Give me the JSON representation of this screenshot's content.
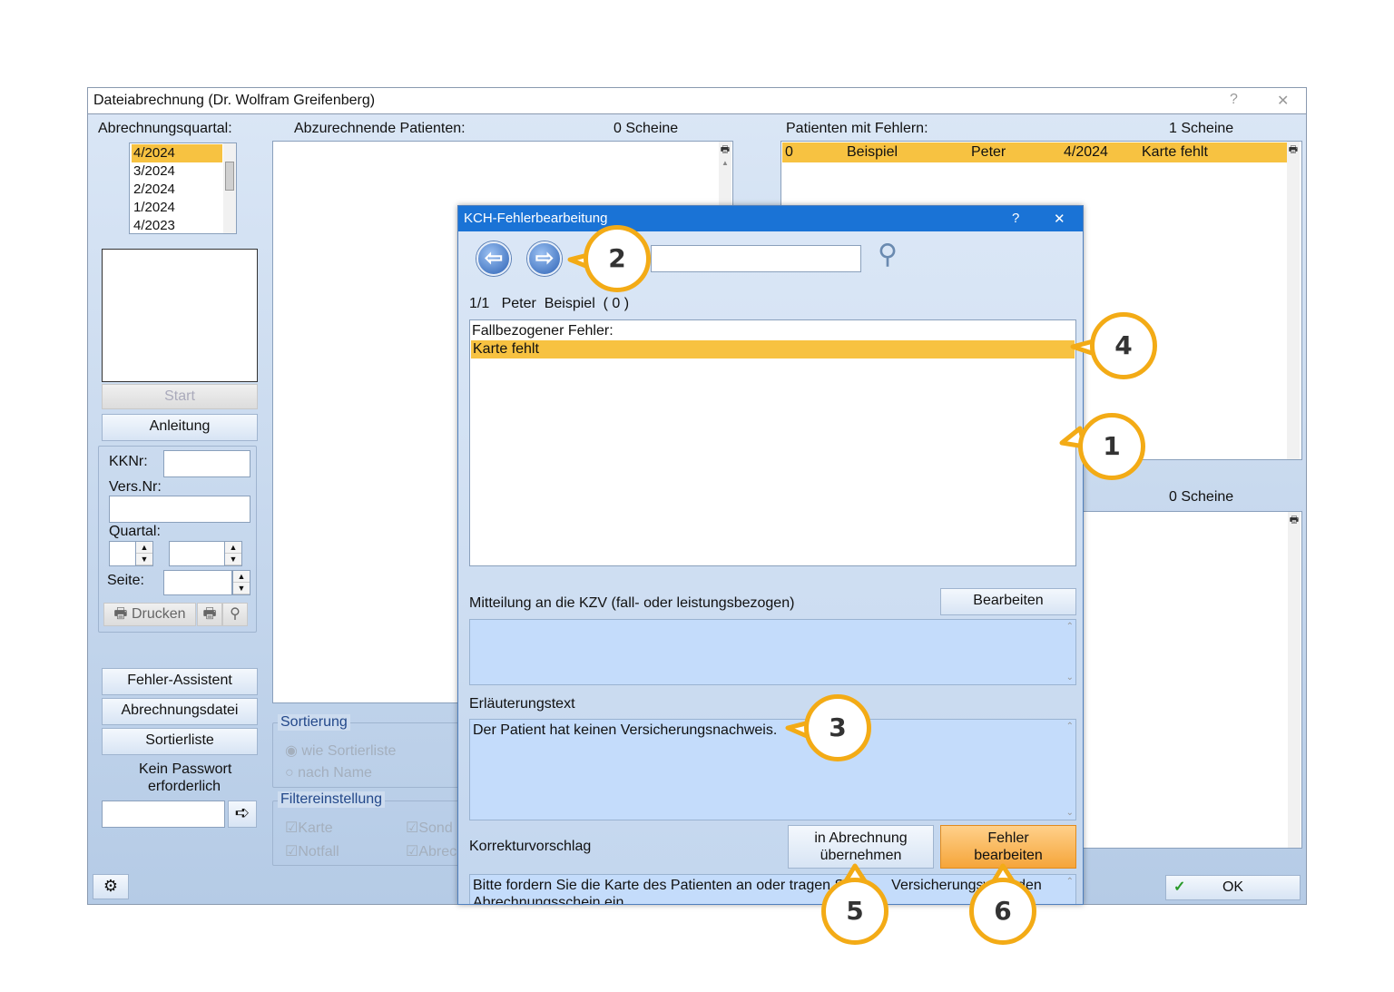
{
  "window": {
    "title": "Dateiabrechnung (Dr. Wolfram Greifenberg)",
    "help": "?",
    "close": "✕"
  },
  "left": {
    "quarter_label": "Abrechnungsquartal:",
    "quarters": [
      "4/2024",
      "3/2024",
      "2/2024",
      "1/2024",
      "4/2023"
    ],
    "start": "Start",
    "anleitung": "Anleitung",
    "kknr_label": "KKNr:",
    "versnr_label": "Vers.Nr:",
    "quartal_label": "Quartal:",
    "seite_label": "Seite:",
    "drucken": "Drucken",
    "fehler_assistent": "Fehler-Assistent",
    "abrechnungsdatei": "Abrechnungsdatei",
    "sortierliste": "Sortierliste",
    "password_line1": "Kein Passwort",
    "password_line2": "erforderlich"
  },
  "middle": {
    "patients_label": "Abzurechnende Patienten:",
    "patients_count": "0  Scheine",
    "sort_title": "Sortierung",
    "sort_opt1": "wie Sortierliste",
    "sort_opt2": "nach Name",
    "filter_title": "Filtereinstellung",
    "filter_karte": "Karte",
    "filter_notfall": "Notfall",
    "filter_sond": "Sond",
    "filter_abrec": "Abrec"
  },
  "right": {
    "errors_label": "Patienten mit Fehlern:",
    "errors_count": "1  Scheine",
    "row": {
      "nr": "0",
      "name": "Beispiel",
      "first": "Peter",
      "quarter": "4/2024",
      "error": "Karte fehlt"
    },
    "lower_count": "0  Scheine",
    "ok": "OK"
  },
  "dialog": {
    "title": "KCH-Fehlerbearbeitung",
    "help": "?",
    "close": "✕",
    "search_value": "",
    "patient_line": "1/1   Peter  Beispiel  ( 0 )",
    "error_list_header": "Fallbezogener Fehler:",
    "error_list_item": "Karte fehlt",
    "mitteilung_label": "Mitteilung an die KZV (fall- oder leistungsbezogen)",
    "bearbeiten": "Bearbeiten",
    "erlaeuterung_label": "Erläuterungstext",
    "erlaeuterung_text": "Der Patient hat keinen Versicherungsnachweis.",
    "korrektur_label": "Korrekturvorschlag",
    "in_abrechnung_1": "in Abrechnung",
    "in_abrechnung_2": "übernehmen",
    "fehler_bearbeiten_1": "Fehler",
    "fehler_bearbeiten_2": "bearbeiten",
    "korrektur_text_1": "Bitte fordern Sie die Karte des Patienten an oder tragen S",
    "korrektur_text_2": "Versicherungsw",
    "korrektur_text_3": "den",
    "korrektur_text_4": "Abrechnungsschein ein."
  },
  "callouts": [
    "1",
    "2",
    "3",
    "4",
    "5",
    "6"
  ],
  "colors": {
    "accent": "#f3ab16",
    "selection": "#f7c241",
    "title_blue": "#1a73d6"
  }
}
